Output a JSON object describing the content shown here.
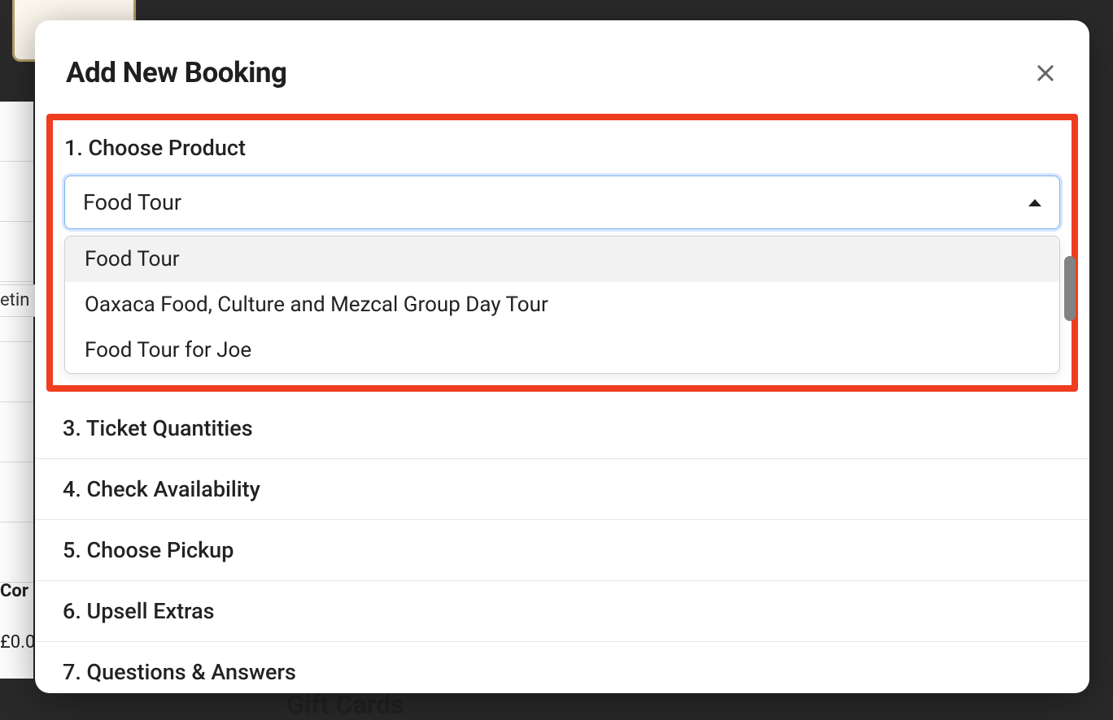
{
  "background": {
    "left_text1": "etin",
    "left_text2": "Cor",
    "left_text3": "£0.0",
    "gift_cards": "Gift Cards"
  },
  "modal": {
    "title": "Add New Booking",
    "step1": {
      "label": "1. Choose Product",
      "selected": "Food Tour",
      "options": [
        "Food Tour",
        "Oaxaca Food, Culture and Mezcal Group Day Tour",
        "Food Tour for Joe"
      ]
    },
    "steps": [
      "3. Ticket Quantities",
      "4. Check Availability",
      "5. Choose Pickup",
      "6. Upsell Extras",
      "7. Questions & Answers"
    ]
  }
}
